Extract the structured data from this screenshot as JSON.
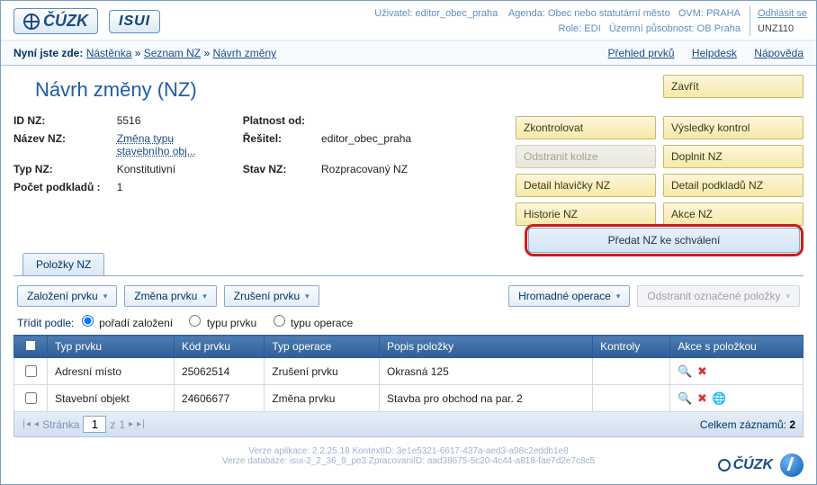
{
  "header": {
    "user_label": "Uživatel:",
    "user": "editor_obec_praha",
    "agenda_label": "Agenda:",
    "agenda": "Obec nebo statutární město",
    "ovm_label": "OVM:",
    "ovm": "PRAHA",
    "role_label": "Role:",
    "role": "EDI",
    "scope_label": "Územní působnost:",
    "scope": "OB Praha",
    "logout": "Odhlásit se",
    "app_code": "UNZ110",
    "logo_cuzk": "ČÚZK",
    "logo_isui": "ISUI"
  },
  "breadcrumb": {
    "prefix": "Nyní jste zde:",
    "items": [
      "Nástěnka",
      "Seznam NZ",
      "Návrh změny"
    ],
    "links": {
      "prehled": "Přehled prvků",
      "helpdesk": "Helpdesk",
      "napoveda": "Nápověda"
    }
  },
  "title": "Návrh změny (NZ)",
  "meta": {
    "id_label": "ID NZ:",
    "id": "5516",
    "name_label": "Název NZ:",
    "name": "Změna typu stavebního obj...",
    "type_label": "Typ NZ:",
    "type": "Konstitutivní",
    "docs_label": "Počet podkladů :",
    "docs": "1",
    "validity_label": "Platnost od:",
    "validity": "",
    "solver_label": "Řešitel:",
    "solver": "editor_obec_praha",
    "state_label": "Stav NZ:",
    "state": "Rozpracovaný NZ"
  },
  "buttons": {
    "close": "Zavřít",
    "check": "Zkontrolovat",
    "results": "Výsledky kontrol",
    "remove_coll": "Odstranit kolize",
    "fill": "Doplnit NZ",
    "header_detail": "Detail hlavičky NZ",
    "docs_detail": "Detail podkladů NZ",
    "history": "Historie NZ",
    "actions": "Akce NZ",
    "submit_action": "Předat NZ ke schválení"
  },
  "tab": "Položky NZ",
  "toolbar": {
    "create": "Založení prvku",
    "change": "Změna prvku",
    "cancel": "Zrušení prvku",
    "bulk": "Hromadné operace",
    "remove_marked": "Odstranit označené položky"
  },
  "sort": {
    "label": "Třídit podle:",
    "options": [
      "pořadí založení",
      "typu prvku",
      "typu operace"
    ],
    "selected": 0
  },
  "table": {
    "cols": [
      "Typ prvku",
      "Kód prvku",
      "Typ operace",
      "Popis položky",
      "Kontroly",
      "Akce s položkou"
    ],
    "rows": [
      {
        "typ": "Adresní místo",
        "kod": "25062514",
        "op": "Zrušení prvku",
        "popis": "Okrasná 125",
        "kontroly": "",
        "icons": [
          "magnify",
          "delete"
        ]
      },
      {
        "typ": "Stavební objekt",
        "kod": "24606677",
        "op": "Změna prvku",
        "popis": "Stavba pro obchod na par. 2",
        "kontroly": "",
        "icons": [
          "magnify",
          "delete",
          "globe"
        ]
      }
    ]
  },
  "pager": {
    "label_page": "Stránka",
    "page": "1",
    "of_label": "z",
    "of": "1",
    "total_label": "Celkem záznamů:",
    "total": "2"
  },
  "footer": {
    "line1": "Verze aplikace: 2.2.25.18 KontextID: 3e1e5321-6617-437a-aed3-a98c2eddb1e8",
    "line2": "Verze databáze: isui-2_2_36_9_pe3 ZpracovaniID: aad38675-5c20-4c44-a818-fae7d2e7c8c5"
  }
}
